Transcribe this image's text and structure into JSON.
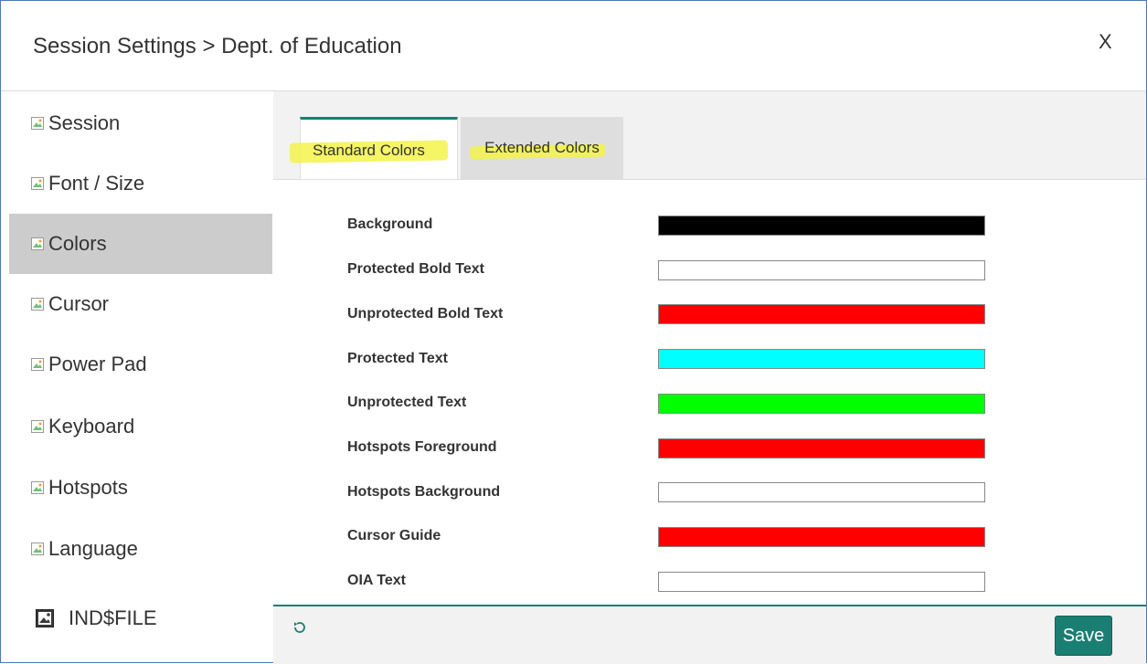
{
  "dialog": {
    "title": "Session Settings > Dept. of Education",
    "close_label": "X"
  },
  "sidebar": {
    "items": [
      {
        "label": "Session",
        "icon": "broken-image-icon"
      },
      {
        "label": "Font / Size",
        "icon": "broken-image-icon"
      },
      {
        "label": "Colors",
        "icon": "broken-image-icon",
        "active": true
      },
      {
        "label": "Cursor",
        "icon": "broken-image-icon"
      },
      {
        "label": "Power Pad",
        "icon": "broken-image-icon"
      },
      {
        "label": "Keyboard",
        "icon": "broken-image-icon"
      },
      {
        "label": "Hotspots",
        "icon": "broken-image-icon"
      },
      {
        "label": "Language",
        "icon": "broken-image-icon"
      },
      {
        "label": "IND$FILE",
        "icon": "file-transfer-icon"
      }
    ]
  },
  "tabs": [
    {
      "label": "Standard Colors",
      "active": true
    },
    {
      "label": "Extended Colors",
      "active": false
    }
  ],
  "colors": [
    {
      "label": "Background",
      "color": "#000000"
    },
    {
      "label": "Protected Bold Text",
      "color": "#ffffff"
    },
    {
      "label": "Unprotected Bold Text",
      "color": "#ff0000"
    },
    {
      "label": "Protected Text",
      "color": "#00ffff"
    },
    {
      "label": "Unprotected Text",
      "color": "#00ff00"
    },
    {
      "label": "Hotspots Foreground",
      "color": "#ff0000"
    },
    {
      "label": "Hotspots Background",
      "color": "#ffffff"
    },
    {
      "label": "Cursor Guide",
      "color": "#ff0000"
    },
    {
      "label": "OIA Text",
      "color": "#ffffff"
    }
  ],
  "footer": {
    "reset_icon": "reset-icon",
    "save_label": "Save"
  },
  "theme": {
    "accent": "#1b7e73",
    "highlight": "#f3f34a"
  }
}
